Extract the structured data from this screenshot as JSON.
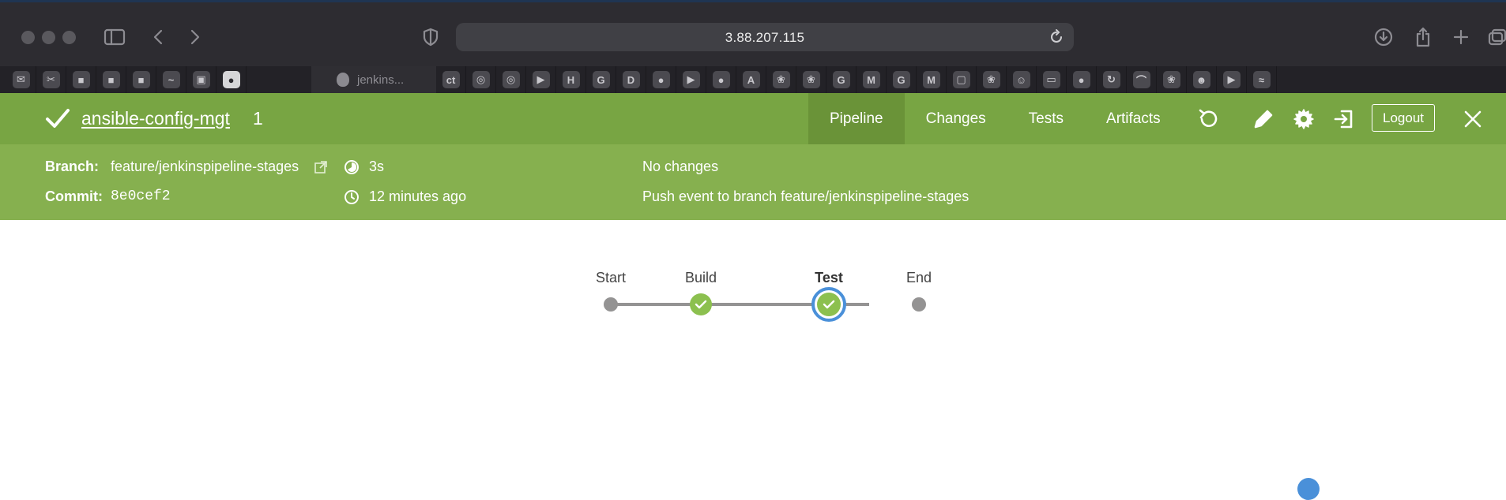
{
  "browser": {
    "url": "3.88.207.115",
    "active_tab_label": "jenkins...",
    "favicons_left": [
      "mail-icon",
      "scissors-icon",
      "video-icon",
      "video-icon",
      "video-icon",
      "wave-icon",
      "box-icon",
      "github-icon"
    ],
    "favicons_right": [
      {
        "name": "ct-icon",
        "glyph": "ct"
      },
      {
        "name": "ring-icon",
        "glyph": "◎"
      },
      {
        "name": "ring-icon",
        "glyph": "◎"
      },
      {
        "name": "youtube-icon",
        "glyph": "▶"
      },
      {
        "name": "h-icon",
        "glyph": "H"
      },
      {
        "name": "google-icon",
        "glyph": "G"
      },
      {
        "name": "d-icon",
        "glyph": "D"
      },
      {
        "name": "github-icon",
        "glyph": "●"
      },
      {
        "name": "youtube-icon",
        "glyph": "▶"
      },
      {
        "name": "github-icon",
        "glyph": "●"
      },
      {
        "name": "a-icon",
        "glyph": "A"
      },
      {
        "name": "jfrog-icon",
        "glyph": "❀"
      },
      {
        "name": "jfrog-icon",
        "glyph": "❀"
      },
      {
        "name": "google-icon",
        "glyph": "G"
      },
      {
        "name": "gmail-icon",
        "glyph": "M"
      },
      {
        "name": "google-icon",
        "glyph": "G"
      },
      {
        "name": "gmail-icon",
        "glyph": "M"
      },
      {
        "name": "app-icon",
        "glyph": "▢"
      },
      {
        "name": "jfrog-icon",
        "glyph": "❀"
      },
      {
        "name": "avatar-icon",
        "glyph": "☺"
      },
      {
        "name": "oracle-icon",
        "glyph": "▭"
      },
      {
        "name": "app-icon",
        "glyph": "●"
      },
      {
        "name": "refresh-icon",
        "glyph": "↻"
      },
      {
        "name": "wave-icon",
        "glyph": "⌒"
      },
      {
        "name": "jfrog-icon",
        "glyph": "❀"
      },
      {
        "name": "person-icon",
        "glyph": "☻"
      },
      {
        "name": "youtube-icon",
        "glyph": "▶"
      },
      {
        "name": "wave-icon",
        "glyph": "≈"
      }
    ]
  },
  "run": {
    "job_name": "ansible-config-mgt",
    "run_number": "1",
    "status": "success"
  },
  "nav": {
    "tabs": [
      {
        "label": "Pipeline",
        "active": true
      },
      {
        "label": "Changes",
        "active": false
      },
      {
        "label": "Tests",
        "active": false
      },
      {
        "label": "Artifacts",
        "active": false
      }
    ],
    "logout_label": "Logout"
  },
  "details": {
    "branch_label": "Branch:",
    "branch_value": "feature/jenkinspipeline-stages",
    "commit_label": "Commit:",
    "commit_value": "8e0cef2",
    "duration": "3s",
    "started": "12 minutes ago",
    "changes": "No changes",
    "cause": "Push event to branch feature/jenkinspipeline-stages"
  },
  "pipeline": {
    "stages": [
      {
        "label": "Start",
        "kind": "start"
      },
      {
        "label": "Build",
        "kind": "success"
      },
      {
        "label": "Test",
        "kind": "success",
        "selected": true
      },
      {
        "label": "End",
        "kind": "end"
      }
    ]
  },
  "colors": {
    "header_green": "#78a543",
    "details_green": "#86b04f",
    "success_green": "#8cc04f",
    "selected_blue": "#4a90d9"
  }
}
